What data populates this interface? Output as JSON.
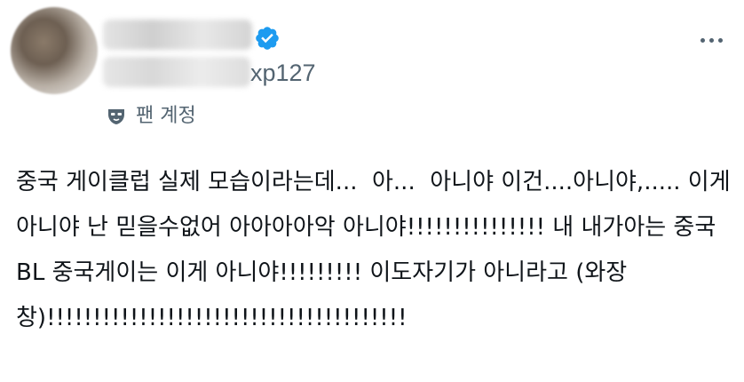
{
  "author": {
    "handle_suffix": "xp127",
    "verified": true
  },
  "badge": {
    "icon": "fan-mask-icon",
    "label": "팬 계정"
  },
  "menu": {
    "icon": "more-options-icon"
  },
  "tweet": {
    "text": "중국 게이클럽 실제 모습이라는데...  아...  아니야 이건....아니야,..... 이게아니야 난 믿을수없어 아아아아악 아니야!!!!!!!!!!!!!!! 내 내가아는 중국BL 중국게이는 이게 아니야!!!!!!!!! 이도자기가 아니라고 (와장창)!!!!!!!!!!!!!!!!!!!!!!!!!!!!!!!!!!!!!!!"
  },
  "colors": {
    "text": "#0f1419",
    "secondary": "#536471",
    "verified": "#1d9bf0"
  }
}
